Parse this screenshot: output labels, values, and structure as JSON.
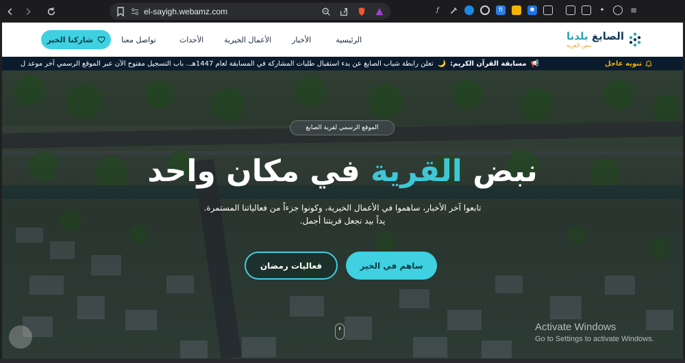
{
  "browser": {
    "url": "el-sayigh.webamz.com"
  },
  "header": {
    "cta_label": "شاركنا الخير",
    "nav": [
      "الرئيسية",
      "الأخبار",
      "الأعمال الخيرية",
      "الأحداث",
      "تواصل معنا"
    ],
    "logo_name_a": "الصايغ",
    "logo_name_b": "بلدنا",
    "logo_sub": "نبض القرية"
  },
  "ticker": {
    "label": "تنويه عاجل",
    "headline": "مسابقة القرآن الكريم:",
    "text": "تعلن رابطة شباب الصايغ عن بدء استقبال طلبات المشاركة في المسابقة لعام 1447هـ.. باب التسجيل مفتوح الآن عبر الموقع الرسمي آخر موعد ل"
  },
  "hero": {
    "pill": "الموقع الرسمي لقرية الصايغ",
    "title_a": "نبض",
    "title_accent": "القرية",
    "title_b": "في مكان واحد",
    "desc_line1": "تابعوا آخر الأخبار، ساهموا في الأعمال الخيرية، وكونوا جزءاً من فعالياتنا المستمرة.",
    "desc_line2": "يداً بيد نجعل قريتنا أجمل.",
    "btn_primary": "ساهم في الخير",
    "btn_secondary": "فعاليات رمضان"
  },
  "os": {
    "activate_title": "Activate Windows",
    "activate_sub": "Go to Settings to activate Windows."
  },
  "colors": {
    "accent": "#3fd1e1",
    "ticker_bg": "#0b1b2e",
    "ticker_label": "#f4b400"
  }
}
